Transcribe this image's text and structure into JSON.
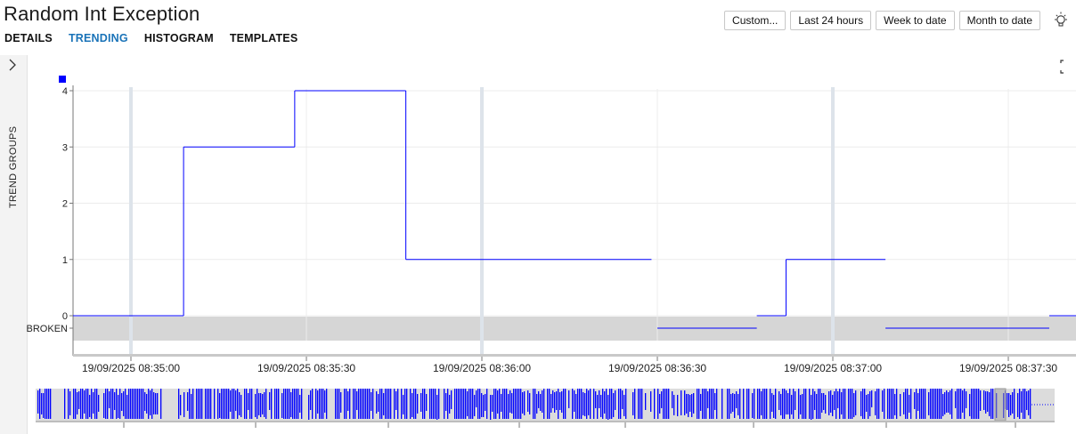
{
  "window": {
    "title": "Random Int Exception"
  },
  "tabs": [
    {
      "label": "DETAILS",
      "active": false
    },
    {
      "label": "TRENDING",
      "active": true
    },
    {
      "label": "HISTOGRAM",
      "active": false
    },
    {
      "label": "TEMPLATES",
      "active": false
    }
  ],
  "toolbar": {
    "custom_label": "Custom...",
    "last24_label": "Last 24 hours",
    "week_label": "Week to date",
    "month_label": "Month to date",
    "bulb_icon": "lightbulb-icon",
    "expand_icon": "fullscreen-icon"
  },
  "sidebar": {
    "label": "TREND GROUPS",
    "toggle_icon": "chevron-right-icon"
  },
  "colors": {
    "series": "#0000ff",
    "accent_tab": "#1a73b8",
    "broken_band": "#d6d6d6",
    "marker_lines": "#dde3ea"
  },
  "chart_data": {
    "type": "line",
    "step": true,
    "title": "",
    "xlabel": "",
    "ylabel": "",
    "ylim": [
      0,
      4
    ],
    "y_ticks": [
      "0",
      "1",
      "2",
      "3",
      "4"
    ],
    "broken_label": "BROKEN",
    "x_tick_labels": [
      "19/09/2025 08:35:00",
      "19/09/2025 08:35:30",
      "19/09/2025 08:36:00",
      "19/09/2025 08:36:30",
      "19/09/2025 08:37:00",
      "19/09/2025 08:37:30"
    ],
    "x_range": [
      "19/09/2025 08:34:50",
      "19/09/2025 08:37:35"
    ],
    "segments": [
      {
        "from": "19/09/2025 08:34:50",
        "to": "19/09/2025 08:35:09",
        "value": 0
      },
      {
        "from": "19/09/2025 08:35:09",
        "to": "19/09/2025 08:35:28",
        "value": 3
      },
      {
        "from": "19/09/2025 08:35:28",
        "to": "19/09/2025 08:35:47",
        "value": 4
      },
      {
        "from": "19/09/2025 08:35:47",
        "to": "19/09/2025 08:36:29",
        "value": 1
      },
      {
        "from": "19/09/2025 08:36:30",
        "to": "19/09/2025 08:36:47",
        "value": "BROKEN"
      },
      {
        "from": "19/09/2025 08:36:47",
        "to": "19/09/2025 08:36:52",
        "value": 0
      },
      {
        "from": "19/09/2025 08:36:52",
        "to": "19/09/2025 08:37:09",
        "value": 1
      },
      {
        "from": "19/09/2025 08:37:09",
        "to": "19/09/2025 08:37:37",
        "value": "BROKEN"
      },
      {
        "from": "19/09/2025 08:37:37",
        "to": "19/09/2025 08:37:42",
        "value": 0
      }
    ],
    "grid": true,
    "legend": "top-left",
    "marker_times": [
      "19/09/2025 08:35:00",
      "19/09/2025 08:36:00",
      "19/09/2025 08:37:00"
    ]
  }
}
